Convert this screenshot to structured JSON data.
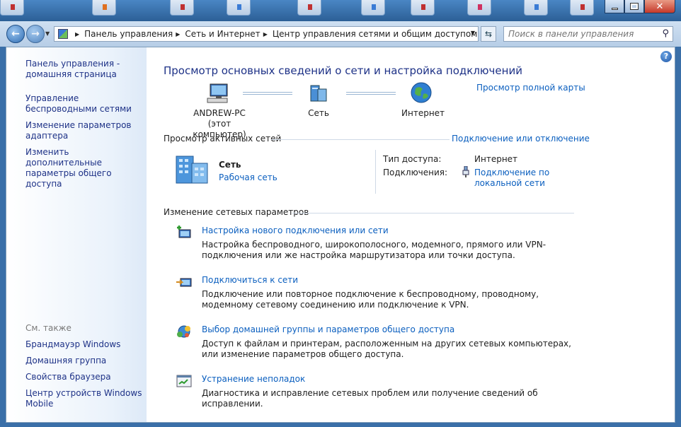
{
  "window": {
    "title_buttons": {
      "minimize": "minimize-icon",
      "maximize": "maximize-icon",
      "close": "✕"
    }
  },
  "address_bar": {
    "crumbs": [
      "Панель управления",
      "Сеть и Интернет",
      "Центр управления сетями и общим доступом"
    ],
    "search_placeholder": "Поиск в панели управления"
  },
  "sidebar": {
    "links": [
      "Панель управления - домашняя страница",
      "Управление беспроводными сетями",
      "Изменение параметров адаптера",
      "Изменить дополнительные параметры общего доступа"
    ],
    "see_also_label": "См. также",
    "see_also": [
      "Брандмауэр Windows",
      "Домашняя группа",
      "Свойства браузера",
      "Центр устройств Windows Mobile"
    ]
  },
  "main": {
    "help": "?",
    "title": "Просмотр основных сведений о сети и настройка подключений",
    "map": {
      "full_map_link": "Просмотр полной карты",
      "computer_name": "ANDREW-PC",
      "computer_sub": "(этот компьютер)",
      "network": "Сеть",
      "internet": "Интернет"
    },
    "active": {
      "header": "Просмотр активных сетей",
      "connect_link": "Подключение или отключение",
      "network_name": "Сеть",
      "network_type": "Рабочая сеть",
      "access_label": "Тип доступа:",
      "access_value": "Интернет",
      "connections_label": "Подключения:",
      "connection_value": "Подключение по локальной сети"
    },
    "settings": {
      "header": "Изменение сетевых параметров",
      "tasks": [
        {
          "title": "Настройка нового подключения или сети",
          "desc": "Настройка беспроводного, широкополосного, модемного, прямого или VPN-подключения или же настройка маршрутизатора или точки доступа."
        },
        {
          "title": "Подключиться к сети",
          "desc": "Подключение или повторное подключение к беспроводному, проводному, модемному сетевому соединению или подключение к VPN."
        },
        {
          "title": "Выбор домашней группы и параметров общего доступа",
          "desc": "Доступ к файлам и принтерам, расположенным на других сетевых компьютерах, или изменение параметров общего доступа."
        },
        {
          "title": "Устранение неполадок",
          "desc": "Диагностика и исправление сетевых проблем или получение сведений об исправлении."
        }
      ]
    }
  }
}
